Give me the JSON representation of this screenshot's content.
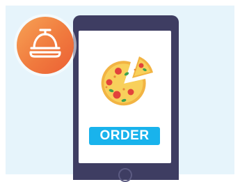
{
  "order_button": {
    "label": "ORDER"
  },
  "icons": {
    "badge": "service-bell-icon",
    "content": "pizza-icon"
  },
  "colors": {
    "background": "#e6f4fb",
    "phone_body": "#3e3d62",
    "badge_gradient_start": "#f7a255",
    "badge_gradient_end": "#ec5f34",
    "button": "#19b3ec",
    "pizza_crust": "#f6c553",
    "pepperoni": "#e2433b",
    "basil": "#3fa34d"
  }
}
